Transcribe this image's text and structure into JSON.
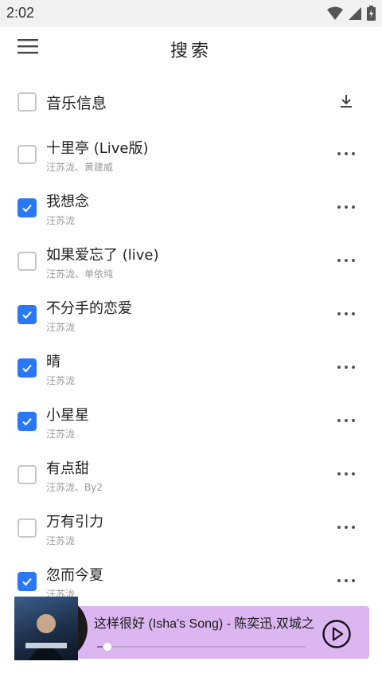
{
  "status_bar": {
    "time": "2:02",
    "icons": [
      "wifi-icon",
      "signal-icon",
      "battery-charging-icon"
    ]
  },
  "app_bar": {
    "title": "搜索",
    "menu_icon": "menu-icon"
  },
  "header": {
    "label": "音乐信息",
    "download_icon": "download-icon"
  },
  "accent_color": "#2a78f5",
  "songs": [
    {
      "title": "十里亭 (Live版)",
      "artist": "汪苏泷、黄建威",
      "checked": false
    },
    {
      "title": "我想念",
      "artist": "汪苏泷",
      "checked": true
    },
    {
      "title": "如果爱忘了 (live)",
      "artist": "汪苏泷、单依纯",
      "checked": false
    },
    {
      "title": "不分手的恋爱",
      "artist": "汪苏泷",
      "checked": true
    },
    {
      "title": "晴",
      "artist": "汪苏泷",
      "checked": true
    },
    {
      "title": "小星星",
      "artist": "汪苏泷",
      "checked": true
    },
    {
      "title": "有点甜",
      "artist": "汪苏泷、By2",
      "checked": false
    },
    {
      "title": "万有引力",
      "artist": "汪苏泷",
      "checked": false
    },
    {
      "title": "忽而今夏",
      "artist": "汪苏泷",
      "checked": true
    }
  ],
  "player": {
    "now_playing": "这样很好 (Isha's Song) - 陈奕迅,双城之战",
    "progress": 0.05,
    "background_color": "#dcb6f0",
    "play_icon": "play-icon"
  }
}
